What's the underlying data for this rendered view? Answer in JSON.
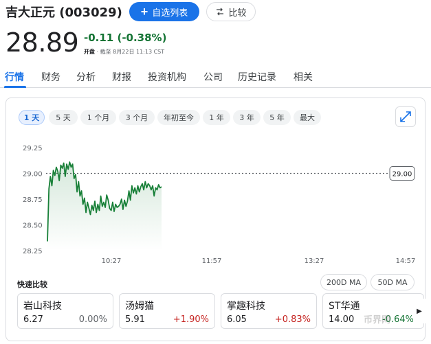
{
  "header": {
    "stock_name": "吉大正元 (003029)",
    "follow_label": "自选列表",
    "compare_label": "比较"
  },
  "quote": {
    "price": "28.89",
    "change": "-0.11 (-0.38%)",
    "market_status": "开盘",
    "as_of": "截至 8月22日 11:13 CST"
  },
  "tabs": [
    {
      "label": "行情",
      "active": true
    },
    {
      "label": "财务"
    },
    {
      "label": "分析"
    },
    {
      "label": "财报"
    },
    {
      "label": "投资机构"
    },
    {
      "label": "公司"
    },
    {
      "label": "历史记录"
    },
    {
      "label": "相关"
    }
  ],
  "ranges": [
    {
      "label": "1 天",
      "active": true
    },
    {
      "label": "5 天"
    },
    {
      "label": "1 个月"
    },
    {
      "label": "3 个月"
    },
    {
      "label": "年初至今"
    },
    {
      "label": "1 年"
    },
    {
      "label": "3 年"
    },
    {
      "label": "5 年"
    },
    {
      "label": "最大"
    }
  ],
  "chart_data": {
    "type": "line",
    "y_ticks": [
      "29.25",
      "29.00",
      "28.75",
      "28.50",
      "28.25"
    ],
    "x_ticks": [
      "10:27",
      "11:57",
      "13:27",
      "14:57"
    ],
    "ylim": [
      28.25,
      29.25
    ],
    "previous_close": 29.0,
    "previous_close_label": "29.00",
    "line_color": "#188038",
    "series": [
      {
        "values": [
          28.34,
          28.85,
          28.97,
          28.88,
          29.03,
          28.98,
          29.06,
          29.02,
          28.93,
          29.08,
          29.05,
          29.1,
          28.97,
          29.09,
          29.04,
          29.11,
          29.06,
          29.09,
          28.95,
          28.99,
          28.82,
          28.92,
          28.78,
          28.83,
          28.7,
          28.76,
          28.62,
          28.72,
          28.66,
          28.6,
          28.69,
          28.64,
          28.73,
          28.62,
          28.7,
          28.64,
          28.78,
          28.68,
          28.72,
          28.67,
          28.79,
          28.74,
          28.66,
          28.64,
          28.72,
          28.63,
          28.7,
          28.67,
          28.68,
          28.7,
          28.75,
          28.65,
          28.74,
          28.68,
          28.73,
          28.83,
          28.74,
          28.88,
          28.81,
          28.86,
          28.8,
          28.88,
          28.82,
          28.87,
          28.9,
          28.84,
          28.92,
          28.86,
          28.9,
          28.88,
          28.84,
          28.88,
          28.78,
          28.86,
          28.84,
          28.89,
          28.86,
          28.87
        ]
      }
    ]
  },
  "quick_compare": {
    "title": "快速比较",
    "ma_buttons": [
      "200D MA",
      "50D MA"
    ],
    "items": [
      {
        "name": "岩山科技",
        "price": "6.27",
        "change": "0.00%",
        "trend": "neutral"
      },
      {
        "name": "汤姆猫",
        "price": "5.91",
        "change": "+1.90%",
        "trend": "up"
      },
      {
        "name": "掌趣科技",
        "price": "6.05",
        "change": "+0.83%",
        "trend": "up"
      },
      {
        "name": "ST华通",
        "price": "14.00",
        "change": "-0.64%",
        "trend": "down"
      }
    ]
  },
  "watermark": "币界网",
  "icons": {
    "follow": "plus-icon",
    "compare": "compare-arrows-icon",
    "expand": "expand-icon",
    "next": "chevron-right-icon"
  }
}
